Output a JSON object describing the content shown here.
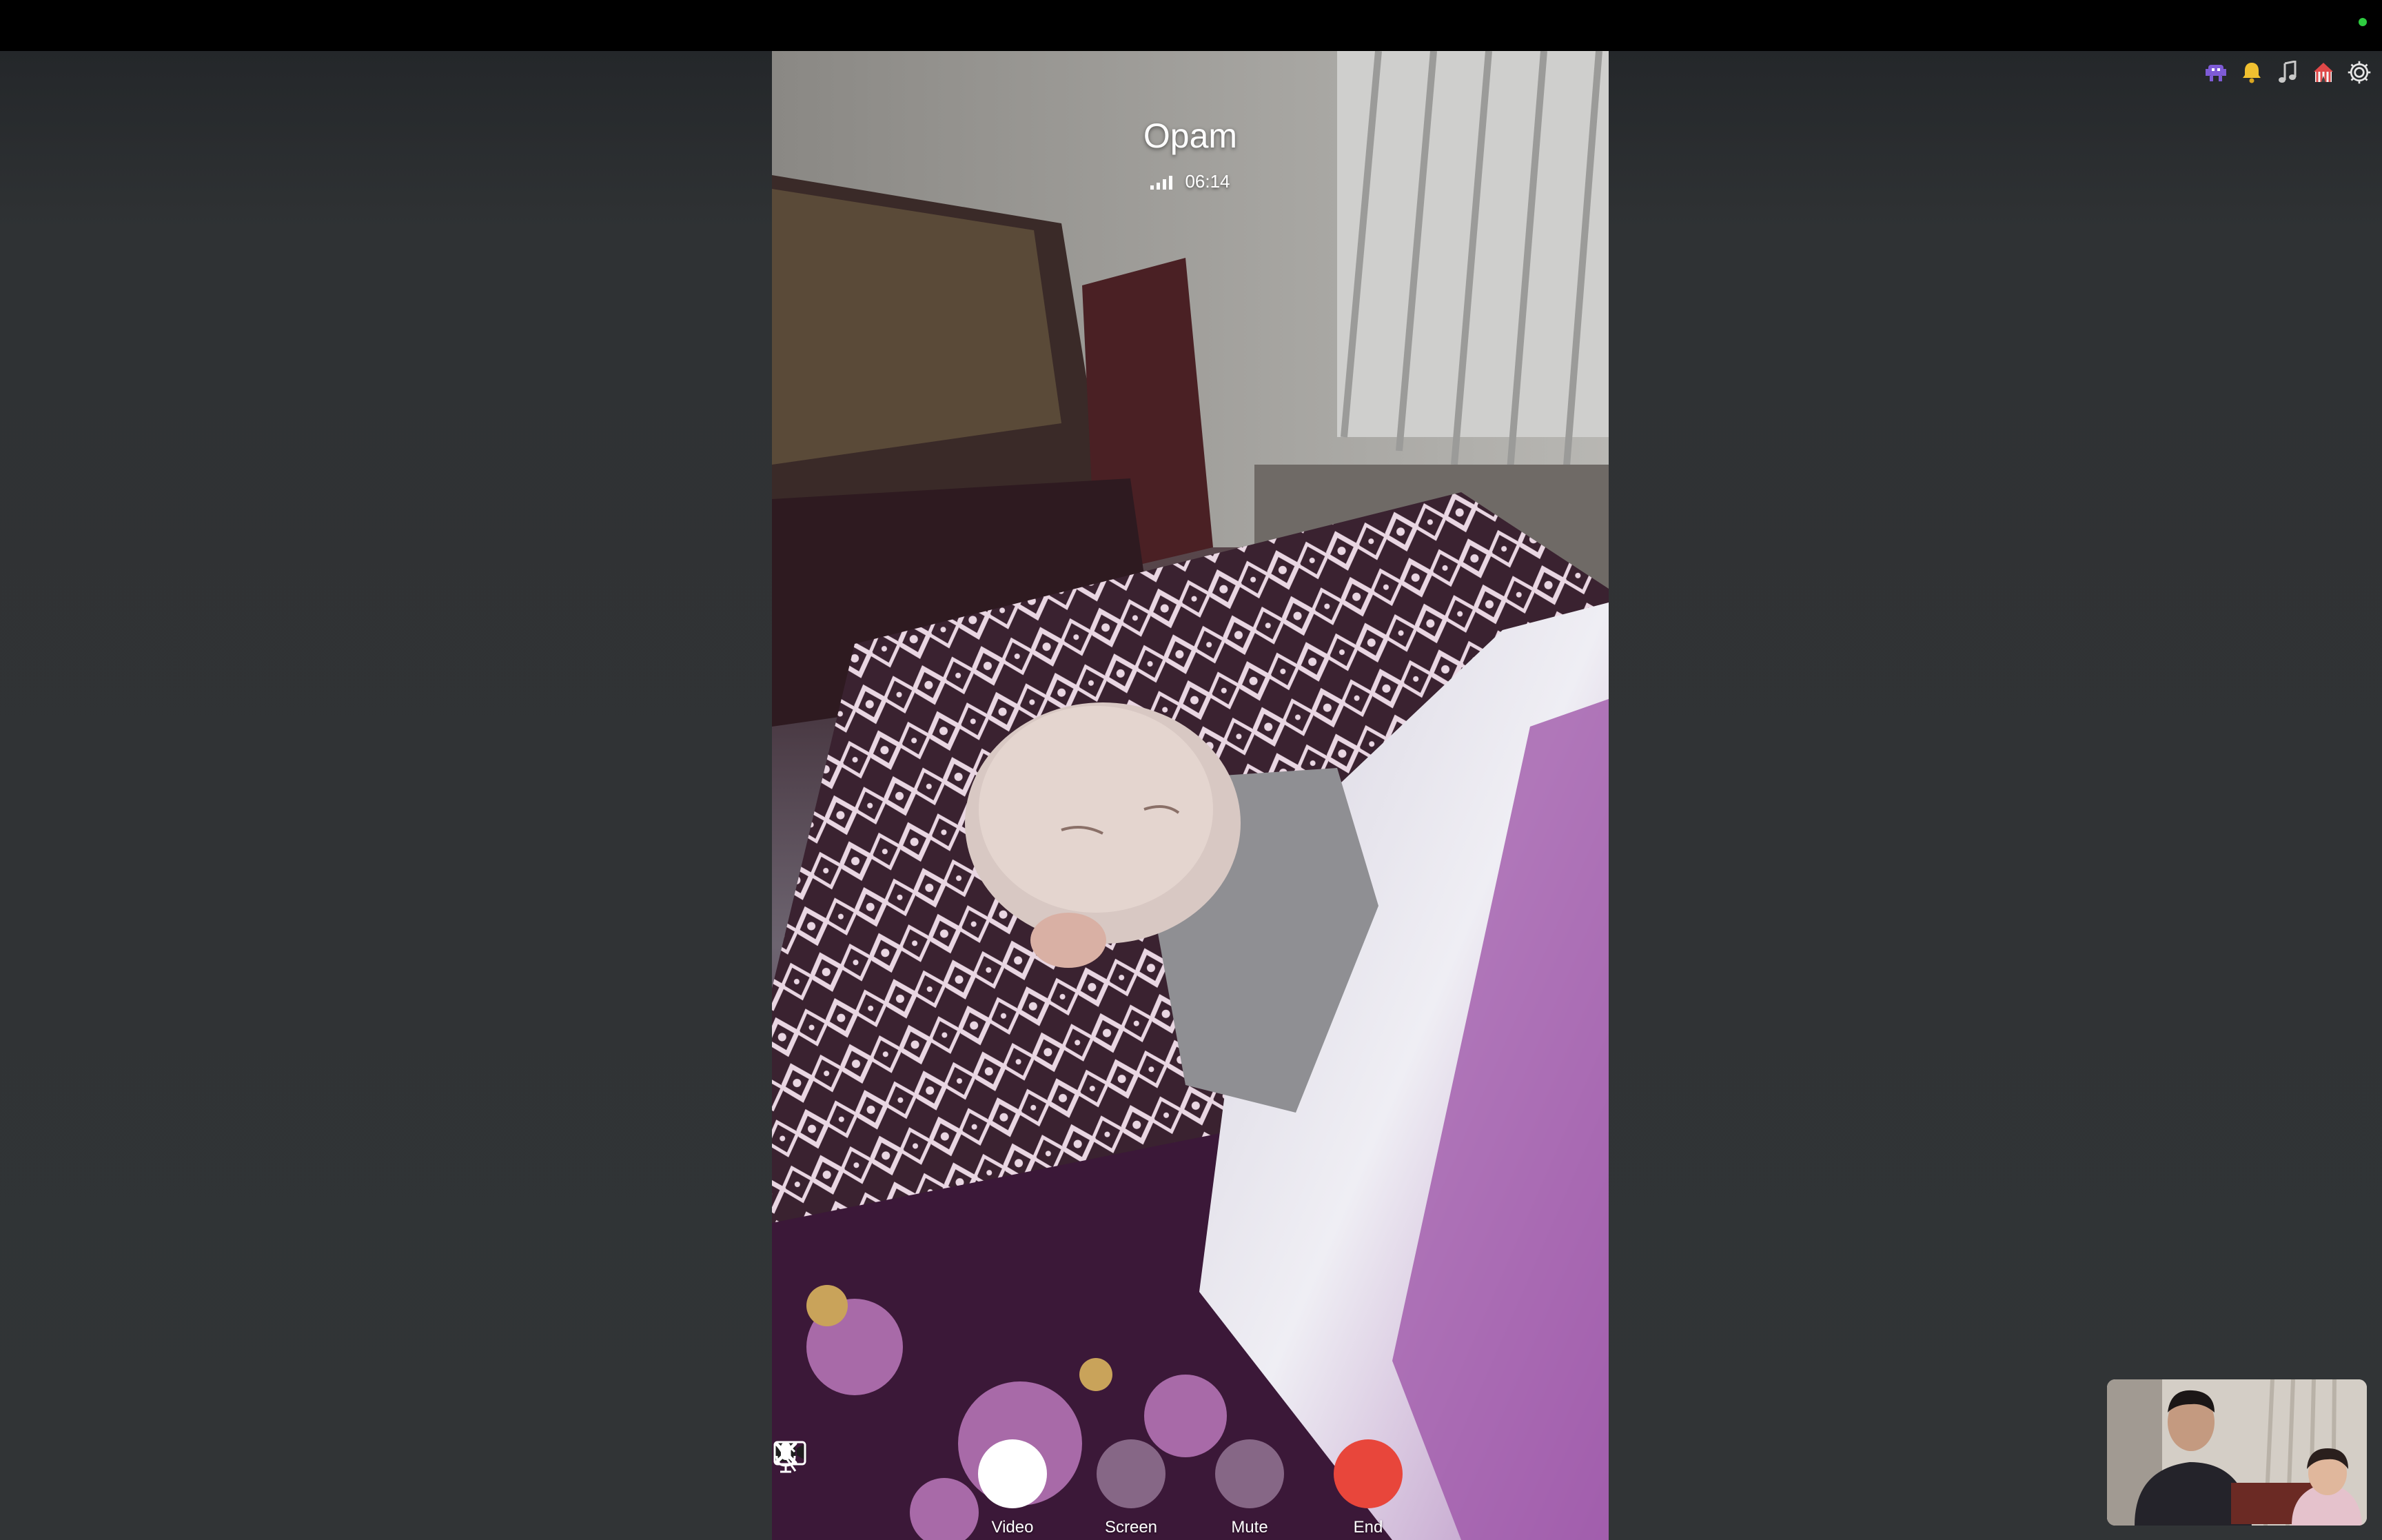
{
  "window": {
    "status_indicator_color": "#2ecc40"
  },
  "tray": {
    "icons": [
      "alien-icon",
      "bell-icon",
      "music-note-icon",
      "circus-tent-icon",
      "gear-icon"
    ]
  },
  "call": {
    "contact_name": "Opam",
    "duration": "06:14",
    "signal_icon": "signal-bars-icon",
    "signal_bars_filled": 4
  },
  "controls": {
    "video_label": "Video",
    "screen_label": "Screen",
    "mute_label": "Mute",
    "end_label": "End",
    "end_color": "#e8463b"
  }
}
